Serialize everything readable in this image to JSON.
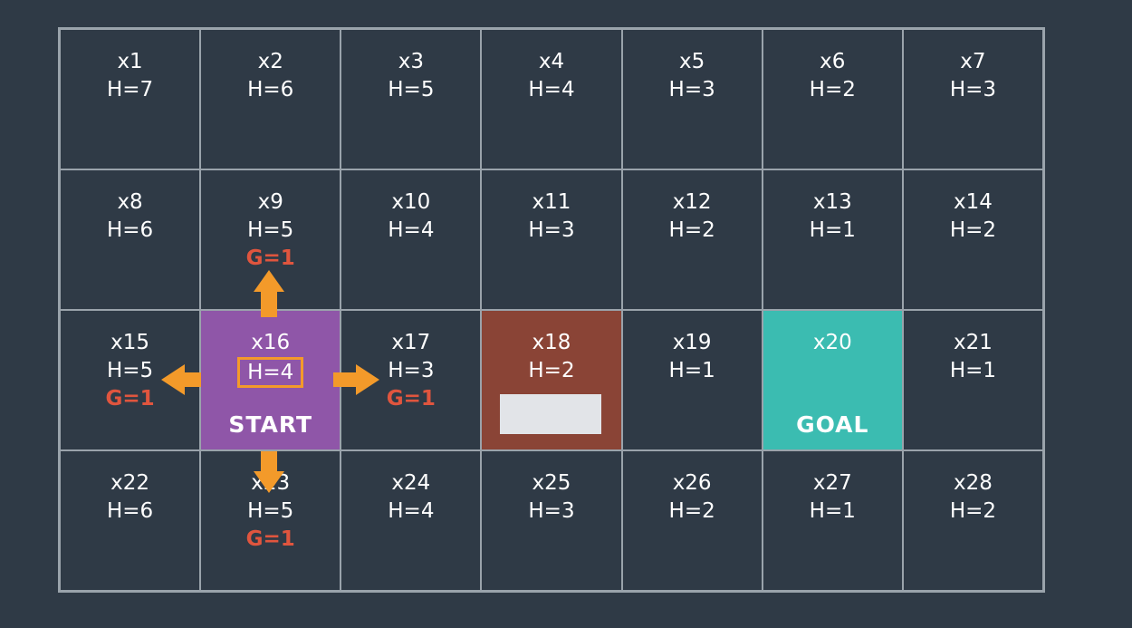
{
  "cells": [
    {
      "id": "x1",
      "h": "H=7"
    },
    {
      "id": "x2",
      "h": "H=6"
    },
    {
      "id": "x3",
      "h": "H=5"
    },
    {
      "id": "x4",
      "h": "H=4"
    },
    {
      "id": "x5",
      "h": "H=3"
    },
    {
      "id": "x6",
      "h": "H=2"
    },
    {
      "id": "x7",
      "h": "H=3"
    },
    {
      "id": "x8",
      "h": "H=6"
    },
    {
      "id": "x9",
      "h": "H=5",
      "g": "G=1"
    },
    {
      "id": "x10",
      "h": "H=4"
    },
    {
      "id": "x11",
      "h": "H=3"
    },
    {
      "id": "x12",
      "h": "H=2"
    },
    {
      "id": "x13",
      "h": "H=1"
    },
    {
      "id": "x14",
      "h": "H=2"
    },
    {
      "id": "x15",
      "h": "H=5",
      "g": "G=1"
    },
    {
      "id": "x16",
      "h": "H=4",
      "tag": "START",
      "kind": "start"
    },
    {
      "id": "x17",
      "h": "H=3",
      "g": "G=1"
    },
    {
      "id": "x18",
      "h": "H=2",
      "kind": "obstacle"
    },
    {
      "id": "x19",
      "h": "H=1"
    },
    {
      "id": "x20",
      "h": "",
      "tag": "GOAL",
      "kind": "goal"
    },
    {
      "id": "x21",
      "h": "H=1"
    },
    {
      "id": "x22",
      "h": "H=6"
    },
    {
      "id": "x23",
      "h": "H=5",
      "g": "G=1"
    },
    {
      "id": "x24",
      "h": "H=4"
    },
    {
      "id": "x25",
      "h": "H=3"
    },
    {
      "id": "x26",
      "h": "H=2"
    },
    {
      "id": "x27",
      "h": "H=1"
    },
    {
      "id": "x28",
      "h": "H=2"
    }
  ],
  "colors": {
    "background": "#2f3a46",
    "grid_line": "#9aa3ab",
    "start": "#8f56a8",
    "obstacle": "#8a4436",
    "goal": "#3bbcb1",
    "g_text": "#e0553e",
    "arrow": "#f39a2a",
    "highlight": "#f39a2a"
  },
  "arrows": [
    "up",
    "left",
    "right",
    "down"
  ]
}
